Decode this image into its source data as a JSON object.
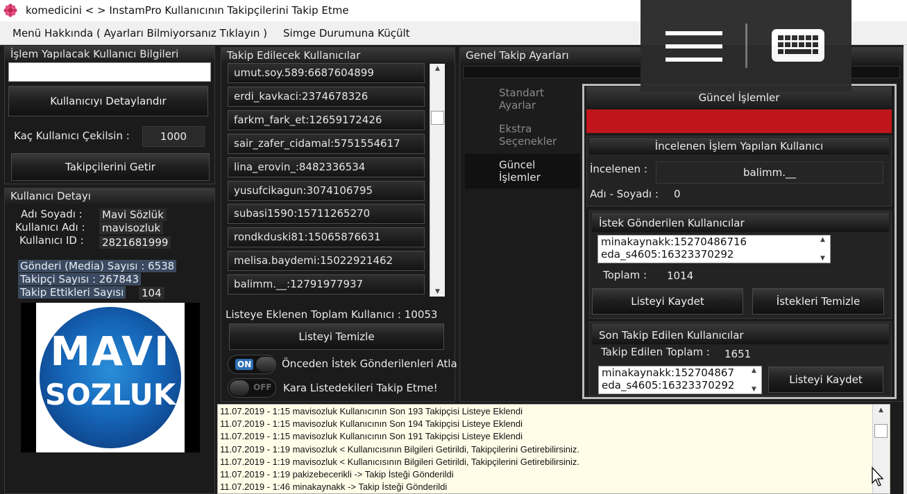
{
  "window": {
    "title": "komedicini < > InstamPro  Kullanıcının Takipçilerini Takip Etme"
  },
  "menu": {
    "about": "Menü Hakkında ( Ayarları Bilmiyorsanız Tıklayın )",
    "minimize": "Simge Durumuna Küçült"
  },
  "user_panel": {
    "header": "İşlem Yapılacak Kullanıcı Bilgileri",
    "input_value": "",
    "detail_button": "Kullanıcıyı Detaylandır",
    "count_label": "Kaç Kullanıcı Çekilsin :",
    "count_value": "1000",
    "fetch_button": "Takipçilerini Getir"
  },
  "user_detail": {
    "header": "Kullanıcı Detayı",
    "name_label": "Adı Soyadı :",
    "name_value": "Mavi Sözlük",
    "username_label": "Kullanıcı Adı :",
    "username_value": "mavisozluk",
    "id_label": "Kullanıcı ID :",
    "id_value": "2821681999",
    "media_label": "Gönderi (Media) Sayısı : 6538",
    "followers_label": "Takipçi Sayısı : 267843",
    "following_label": "Takip Ettikleri Sayısı",
    "following_value": "104",
    "logo_line1": "MAVI",
    "logo_line2": "SOZLUK"
  },
  "follow_list": {
    "header": "Takip Edilecek Kullanıcılar",
    "items": [
      "umut.soy.589:6687604899",
      "erdi_kavkaci:2374678326",
      "farkm_fark_et:12659172426",
      "sair_zafer_cidamal:5751554617",
      "lina_erovin_:8482336534",
      "yusufcikagun:3074106795",
      "subasi1590:15711265270",
      "rondkduski81:15065876631",
      "melisa.baydemi:15022921462",
      "balimm.__:12791977937"
    ],
    "total_label": "Listeye Eklenen Toplam Kullanıcı : 10053",
    "clear_button": "Listeyi Temizle",
    "toggle1_state": "ON",
    "toggle1_label": "Önceden İstek Gönderilenleri Atla",
    "toggle2_state": "OFF",
    "toggle2_label": "Kara Listedekileri Takip Etme!"
  },
  "settings": {
    "header": "Genel Takip Ayarları",
    "tabs": [
      {
        "label_1": "Standart",
        "label_2": "Ayarlar"
      },
      {
        "label_1": "Ekstra",
        "label_2": "Seçenekler"
      },
      {
        "label_1": "Güncel",
        "label_2": "İşlemler"
      }
    ]
  },
  "current_ops": {
    "header": "Güncel İşlemler",
    "progress_color": "#c0161b",
    "inspected_header": "İncelenen İşlem Yapılan Kullanıcı",
    "inspected_label": "İncelenen :",
    "inspected_value": "balimm.__",
    "name_label": "Adı - Soyadı :",
    "name_value": "0",
    "requests_header": "İstek Gönderilen Kullanıcılar",
    "requests": [
      "minakaynakk:15270486716",
      "eda_s4605:16323370292"
    ],
    "total_label": "Toplam :",
    "total_value": "1014",
    "save_button": "Listeyi Kaydet",
    "clear_requests_button": "İstekleri Temizle",
    "last_followed_header": "Son Takip Edilen Kullanıcılar",
    "followed_total_label": "Takip Edilen Toplam :",
    "followed_total_value": "1651",
    "followed": [
      "minakaynakk:152704867",
      "eda_s4605:16323370292"
    ],
    "save_button2": "Listeyi Kaydet"
  },
  "log": {
    "lines": [
      "11.07.2019 - 1:15   mavisozluk Kullanıcının Son 193 Takipçisi Listeye Eklendi",
      "11.07.2019 - 1:15   mavisozluk Kullanıcının Son 194 Takipçisi Listeye Eklendi",
      "11.07.2019 - 1:15   mavisozluk Kullanıcının Son 191 Takipçisi Listeye Eklendi",
      "11.07.2019 - 1:19   mavisozluk < Kullanıcısının Bilgileri Getirildi, Takipçilerini Getirebilirsiniz.",
      "11.07.2019 - 1:19   mavisozluk < Kullanıcısının Bilgileri Getirildi, Takipçilerini Getirebilirsiniz.",
      "11.07.2019 - 1:19   pakizebecerikli -> Takip İsteği Gönderildi",
      "11.07.2019 - 1:46   minakaynakk -> Takip İsteği Gönderildi"
    ]
  }
}
